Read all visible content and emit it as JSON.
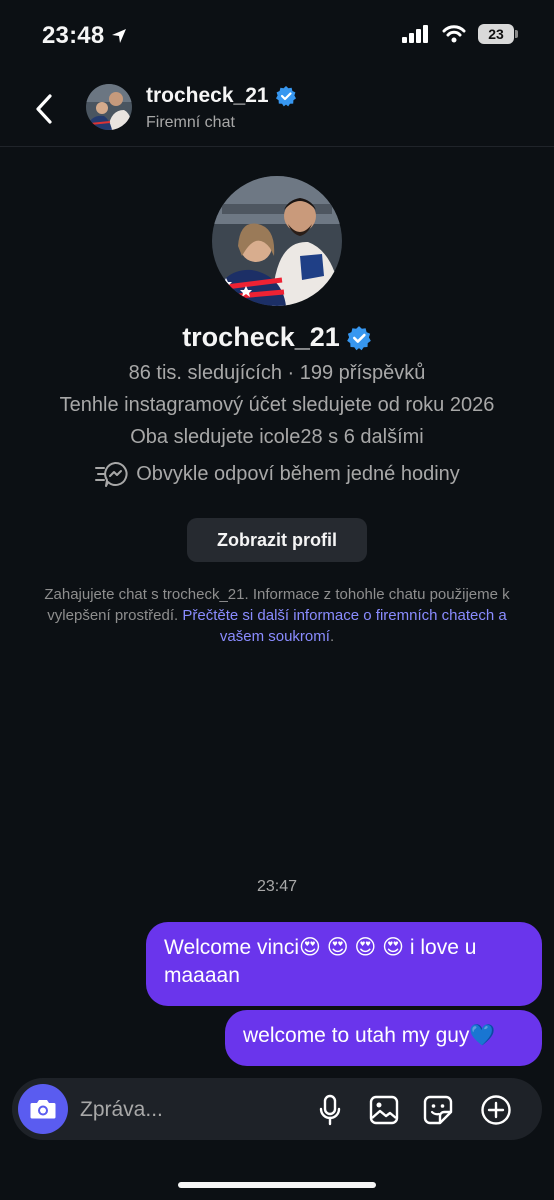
{
  "status_bar": {
    "time": "23:48",
    "battery": "23"
  },
  "header": {
    "username": "trocheck_21",
    "subtitle": "Firemní chat"
  },
  "profile": {
    "username": "trocheck_21",
    "stats": "86 tis. sledujících · 199 příspěvků",
    "following_since": "Tenhle instagramový účet sledujete od roku 2026",
    "mutuals": "Oba sledujete icole28 s 6 dalšími",
    "response_time": "Obvykle odpoví během jedné hodiny",
    "view_profile_label": "Zobrazit profil"
  },
  "disclaimer": {
    "text": "Zahajujete chat s trocheck_21. Informace z tohohle chatu použijeme k vylepšení prostředí. ",
    "link": "Přečtěte si další informace o firemních chatech a vašem soukromí",
    "end": "."
  },
  "messages": {
    "timestamp": "23:47",
    "items": [
      {
        "text": "Welcome vinci😍 😍 😍 😍  i love u maaaan"
      },
      {
        "text": "welcome to utah my guy💙"
      }
    ]
  },
  "composer": {
    "placeholder": "Zpráva..."
  },
  "colors": {
    "background": "#0c1014",
    "bubble": "#6a35ec",
    "camera": "#5a5cf0",
    "link": "#8a8cff",
    "verified": "#3797f0"
  },
  "icons": [
    "location-arrow-icon",
    "signal-icon",
    "wifi-icon",
    "battery-icon",
    "back-chevron-icon",
    "verified-icon",
    "fast-reply-icon",
    "camera-icon",
    "microphone-icon",
    "gallery-icon",
    "sticker-icon",
    "plus-icon"
  ]
}
